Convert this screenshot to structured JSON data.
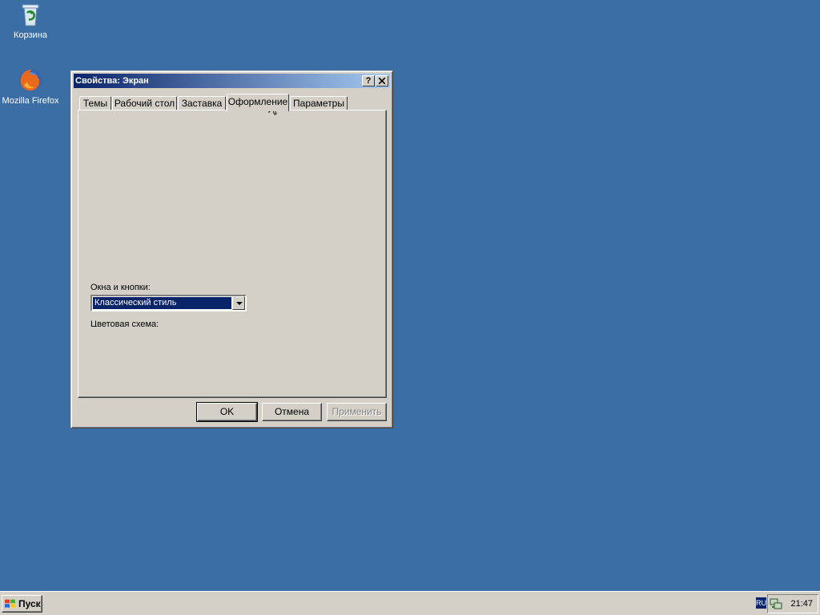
{
  "desktop": {
    "icons": [
      {
        "label": "Корзина",
        "icon": "recycle-bin-icon"
      },
      {
        "label": "Mozilla Firefox",
        "icon": "firefox-icon"
      }
    ],
    "background_color": "#3a6ea5"
  },
  "window": {
    "title": "Свойства: Экран",
    "help_label": "?",
    "close_label": "✕",
    "tabs": [
      {
        "label": "Темы"
      },
      {
        "label": "Рабочий стол"
      },
      {
        "label": "Заставка"
      },
      {
        "label": "Оформление",
        "active": true
      },
      {
        "label": "Параметры"
      }
    ],
    "windows_buttons_label": "Окна и кнопки:",
    "windows_buttons_value": "Классический стиль",
    "color_scheme_label": "Цветовая схема:",
    "buttons": {
      "ok": "OK",
      "cancel": "Отмена",
      "apply": "Применить"
    }
  },
  "taskbar": {
    "start_label": "Пуск",
    "lang": "RU",
    "clock": "21:47"
  },
  "colors": {
    "title_active_start": "#0a246a",
    "title_active_end": "#a6caf0",
    "face": "#d4d0c8",
    "selection": "#0a246a"
  }
}
